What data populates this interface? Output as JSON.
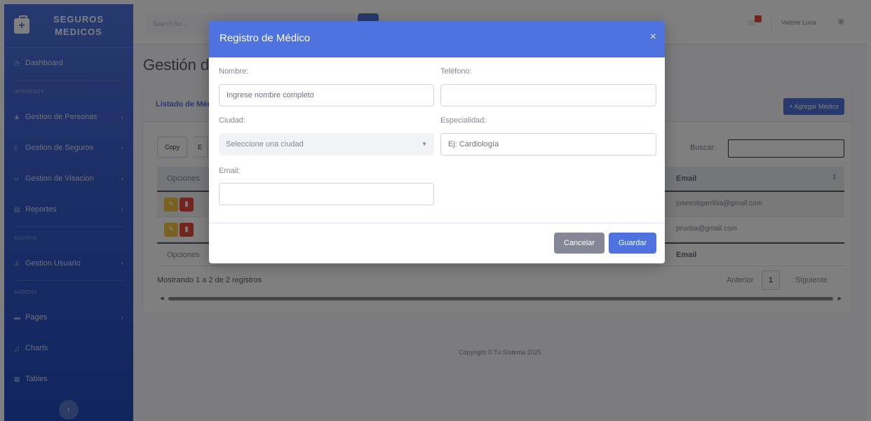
{
  "sidebar": {
    "brand": {
      "line1": "SEGUROS",
      "line2": "MEDICOS"
    },
    "items": [
      {
        "label": "Dashboard",
        "icon": "tachometer-icon"
      },
      {
        "label": "Gestion de Personas",
        "icon": "users-icon"
      },
      {
        "label": "Gestion de Seguros",
        "icon": "file-icon"
      },
      {
        "label": "Gestion de Visacion",
        "icon": "edit-icon"
      },
      {
        "label": "Reportes",
        "icon": "chart-icon"
      },
      {
        "label": "Gestion Usuario",
        "icon": "user-cog-icon"
      },
      {
        "label": "Pages",
        "icon": "folder-icon"
      },
      {
        "label": "Charts",
        "icon": "chart-area-icon"
      },
      {
        "label": "Tables",
        "icon": "table-icon"
      }
    ],
    "headings": [
      "INTERFACE",
      "ADDONS",
      "ADDONS"
    ]
  },
  "topbar": {
    "search_placeholder": "Search for...",
    "user_name": "Valerie Luna"
  },
  "page": {
    "title": "Gestión de Médicos",
    "card_title": "Listado de Médicos",
    "add_button": "+ Agregar Médico",
    "copy_button": "Copy",
    "copy_button2": "E",
    "search_label": "Buscar:",
    "column_options": "Opciones",
    "column_email": "Email",
    "rows": [
      {
        "email": "joseestigarribia@gmail.com"
      },
      {
        "email": "prueba@gmail.com"
      }
    ],
    "info": "Mostrando 1 a 2 de 2 registros",
    "prev": "Anterior",
    "current_page": "1",
    "next": "Siguiente",
    "footer": "Copyright © Tu Sistema 2025"
  },
  "modal": {
    "title": "Registro de Médico",
    "close": "×",
    "nombre_label": "Nombre:",
    "nombre_value": "Ingrese nombre completo",
    "telefono_label": "Teléfono:",
    "telefono_value": "",
    "ciudad_label": "Ciudad:",
    "ciudad_value": "Seleccione una ciudad",
    "especialidad_label": "Especialidad:",
    "especialidad_placeholder": "Ej: Cardiología",
    "email_label": "Email:",
    "email_value": "",
    "cancel": "Cancelar",
    "save": "Guardar"
  },
  "colors": {
    "primary": "#4e73df",
    "secondary": "#858796",
    "warning": "#f6c23e",
    "danger": "#e74a3b"
  }
}
